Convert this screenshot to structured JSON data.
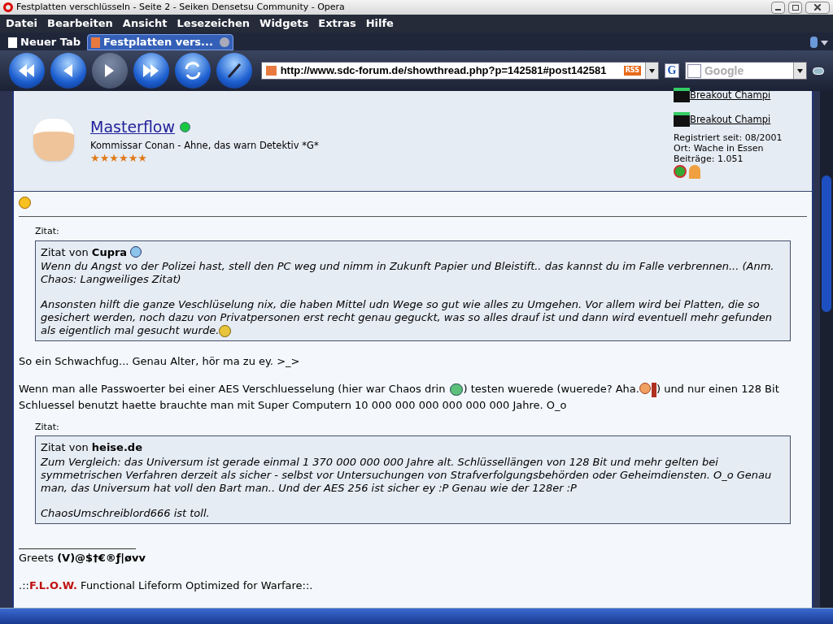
{
  "window": {
    "title": "Festplatten verschlüsseln - Seite 2 - Seiken Densetsu Community - Opera"
  },
  "menu": [
    "Datei",
    "Bearbeiten",
    "Ansicht",
    "Lesezeichen",
    "Widgets",
    "Extras",
    "Hilfe"
  ],
  "tabs": [
    {
      "label": "Neuer Tab",
      "selected": false
    },
    {
      "label": "Festplatten vers...",
      "selected": true
    }
  ],
  "toolbar": [
    {
      "kind": "rewind",
      "disabled": false
    },
    {
      "kind": "back",
      "disabled": false
    },
    {
      "kind": "forward",
      "disabled": true
    },
    {
      "kind": "fastforward",
      "disabled": false
    },
    {
      "kind": "reload",
      "disabled": false
    },
    {
      "kind": "edit",
      "disabled": false
    }
  ],
  "address": {
    "value": "http://www.sdc-forum.de/showthread.php?p=142581#post142581",
    "rss": "RSS"
  },
  "engine_button": "G",
  "search": {
    "placeholder": "Google"
  },
  "post": {
    "user": "Masterflow",
    "online": true,
    "title": "Kommissar Conan - Ahne, das warn Detektiv *G*",
    "stars": 6,
    "awards": [
      "Breakout Champi",
      "Breakout Champi"
    ],
    "info": [
      "Registriert seit: 08/2001",
      "Ort: Wache in Essen",
      "Beiträge: 1.051"
    ],
    "blocks": [
      {
        "kind": "quote",
        "label": "Zitat:",
        "source": "Zitat von **Cupra**",
        "link": true,
        "paragraphs": [
          [
            {
              "kind": "text",
              "text": "Wenn du Angst vo der Polizei hast, stell den PC weg und nimm in Zukunft Papier und Bleistift.. das kannst du im Falle verbrennen... (Anm. Chaos: Langweiliges Zitat)"
            }
          ],
          [
            {
              "kind": "text",
              "text": "Ansonsten hilft die ganze Veschlüselung nix, die haben Mittel udn Wege so gut wie alles zu Umgehen. Vor allem wird bei Platten, die so gesichert werden, noch dazu von Privatpersonen erst recht genau geguckt, was so alles drauf ist und dann wird eventuell mehr gefunden als eigentlich mal gesucht wurde."
            },
            {
              "kind": "smile"
            }
          ]
        ]
      },
      {
        "kind": "paragraph",
        "parts": [
          {
            "kind": "text",
            "text": "So ein Schwachfug... Genau Alter, hör ma zu ey. >_>"
          }
        ]
      },
      {
        "kind": "paragraph",
        "parts": [
          {
            "kind": "text",
            "text": "Wenn man alle Passwoerter bei einer AES Verschluesselung (hier war Chaos drin "
          },
          {
            "kind": "grin"
          },
          {
            "kind": "text",
            "text": ") testen wuerede (wuerede? Aha."
          },
          {
            "kind": "wall"
          },
          {
            "kind": "text",
            "text": ") und nur einen 128 Bit Schluessel benutzt haette brauchte man mit Super Computern 10 000 000 000 000 000 000 Jahre. O_o"
          }
        ]
      },
      {
        "kind": "quote",
        "label": "Zitat:",
        "source": "Zitat von **heise.de**",
        "link": false,
        "paragraphs": [
          [
            {
              "kind": "text",
              "text": "Zum Vergleich: das Universum ist gerade einmal 1 370 000 000 000 Jahre alt. Schlüssellängen von 128 Bit und mehr gelten bei symmetrischen Verfahren derzeit als sicher - selbst vor Untersuchungen von Strafverfolgungsbehörden oder Geheimdiensten. O_o Genau man, das Universum hat voll den Bart man.. Und der AES 256 ist sicher ey :P Genau wie der 128er :P"
            }
          ],
          [
            {
              "kind": "text",
              "text": "ChaosUmschreiblord666 ist toll."
            }
          ]
        ]
      }
    ],
    "signature": {
      "greets": "Greets **(V)@$†€®ƒ|øvv**",
      "prefix": ".::",
      "brand": "F.L.O.W.",
      "motto": "Functional Lifeform Optimized for Warfare::."
    }
  }
}
